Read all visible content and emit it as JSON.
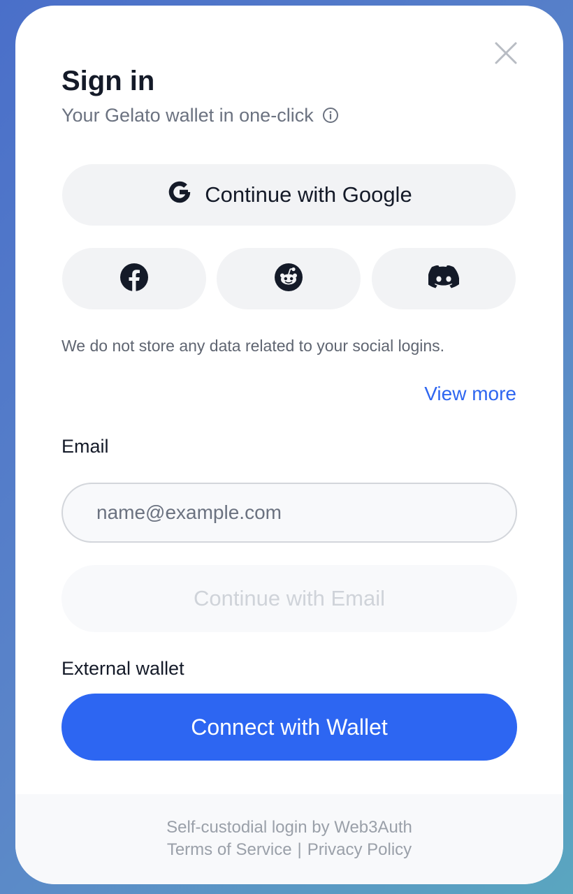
{
  "modal": {
    "title": "Sign in",
    "subtitle": "Your Gelato wallet in one-click",
    "icons": {
      "close": "close-icon",
      "info": "info-icon",
      "google": "google-icon",
      "facebook": "facebook-icon",
      "reddit": "reddit-icon",
      "discord": "discord-icon"
    }
  },
  "social": {
    "google_label": "Continue with Google",
    "notice": "We do not store any data related to your social logins.",
    "view_more": "View more"
  },
  "email": {
    "label": "Email",
    "placeholder": "name@example.com",
    "value": "",
    "continue_label": "Continue with Email"
  },
  "external": {
    "label": "External wallet",
    "connect_label": "Connect with Wallet"
  },
  "footer": {
    "powered_by": "Self-custodial login by Web3Auth",
    "terms": "Terms of Service",
    "separator": "|",
    "privacy": "Privacy Policy"
  },
  "colors": {
    "accent": "#2d66f2",
    "link": "#2e66f0",
    "button_bg": "#f2f3f5",
    "text_primary": "#141a28",
    "text_muted": "#6b7280"
  }
}
